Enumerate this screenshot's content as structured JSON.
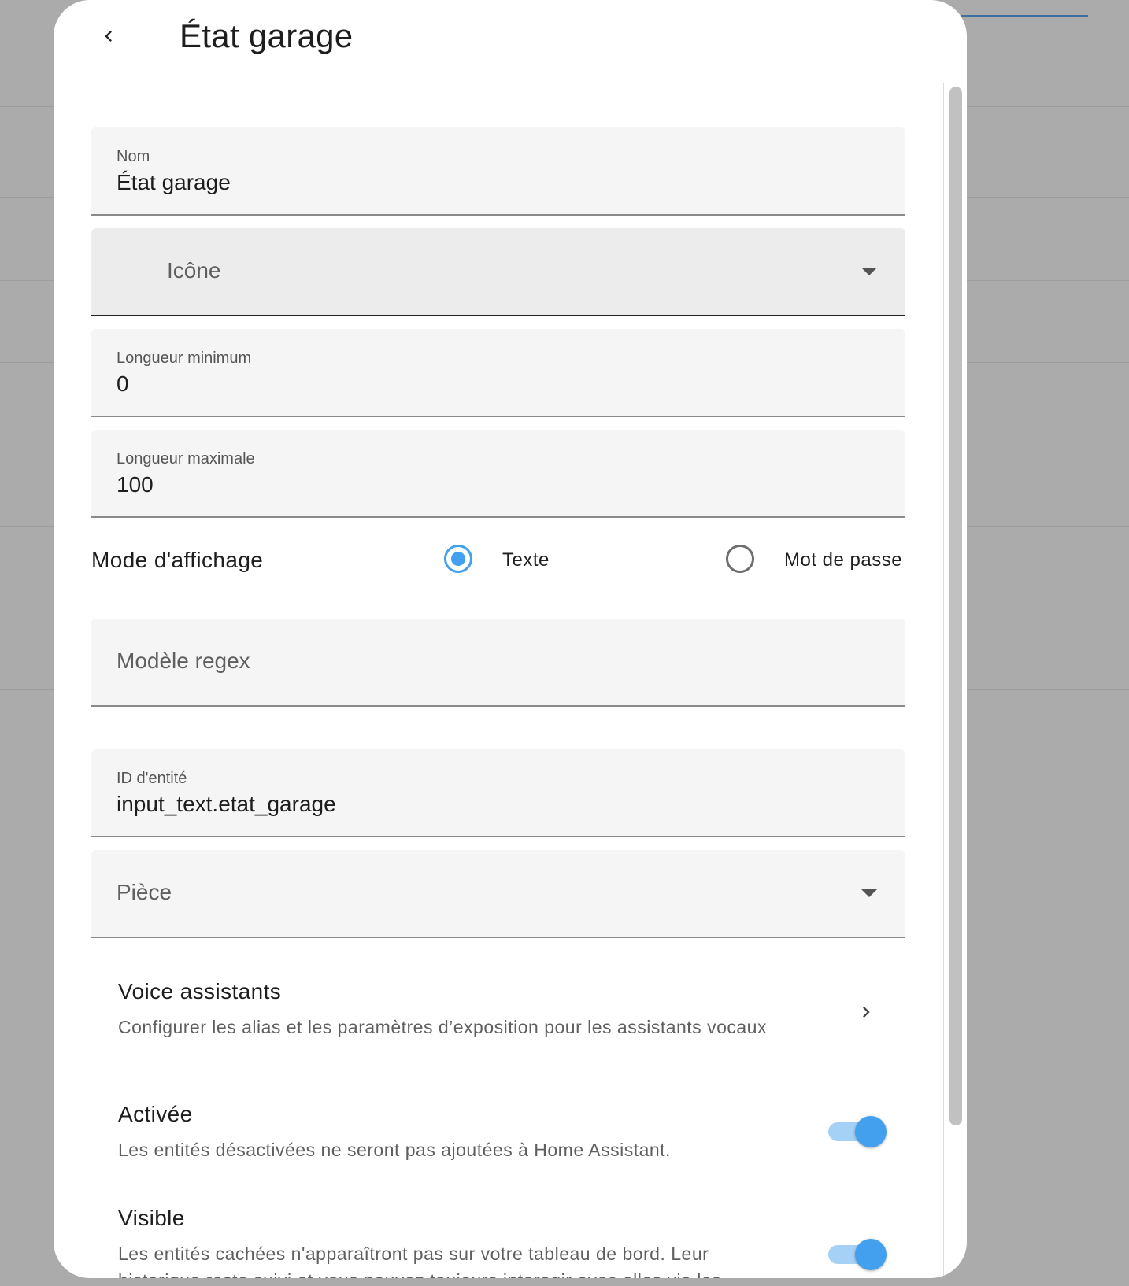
{
  "dialog": {
    "title": "État garage"
  },
  "fields": {
    "name": {
      "label": "Nom",
      "value": "État garage"
    },
    "icon": {
      "placeholder": "Icône"
    },
    "min_length": {
      "label": "Longueur minimum",
      "value": "0"
    },
    "max_length": {
      "label": "Longueur maximale",
      "value": "100"
    },
    "regex": {
      "placeholder": "Modèle regex"
    },
    "entity_id": {
      "label": "ID d'entité",
      "value": "input_text.etat_garage"
    },
    "area": {
      "placeholder": "Pièce"
    }
  },
  "display_mode": {
    "label": "Mode d'affichage",
    "options": [
      "Texte",
      "Mot de passe"
    ],
    "selected": "Texte"
  },
  "voice_assistants": {
    "title": "Voice assistants",
    "subtitle": "Configurer les alias et les paramètres d’exposition pour les assistants vocaux"
  },
  "enabled": {
    "title": "Activée",
    "subtitle": "Les entités désactivées ne seront pas ajoutées à Home Assistant.",
    "on": true
  },
  "visible": {
    "title": "Visible",
    "subtitle": "Les entités cachées n'apparaîtront pas sur votre tableau de bord. Leur historique reste suivi et vous pouvez toujours interagir avec elles via les",
    "on": true
  },
  "colors": {
    "accent": "#42a0ef",
    "backdrop": "#ababab",
    "field_bg": "#f5f5f5"
  },
  "icons": {
    "back": "chevron-left-icon",
    "dropdown": "menu-down-icon",
    "navigate": "chevron-right-icon"
  }
}
